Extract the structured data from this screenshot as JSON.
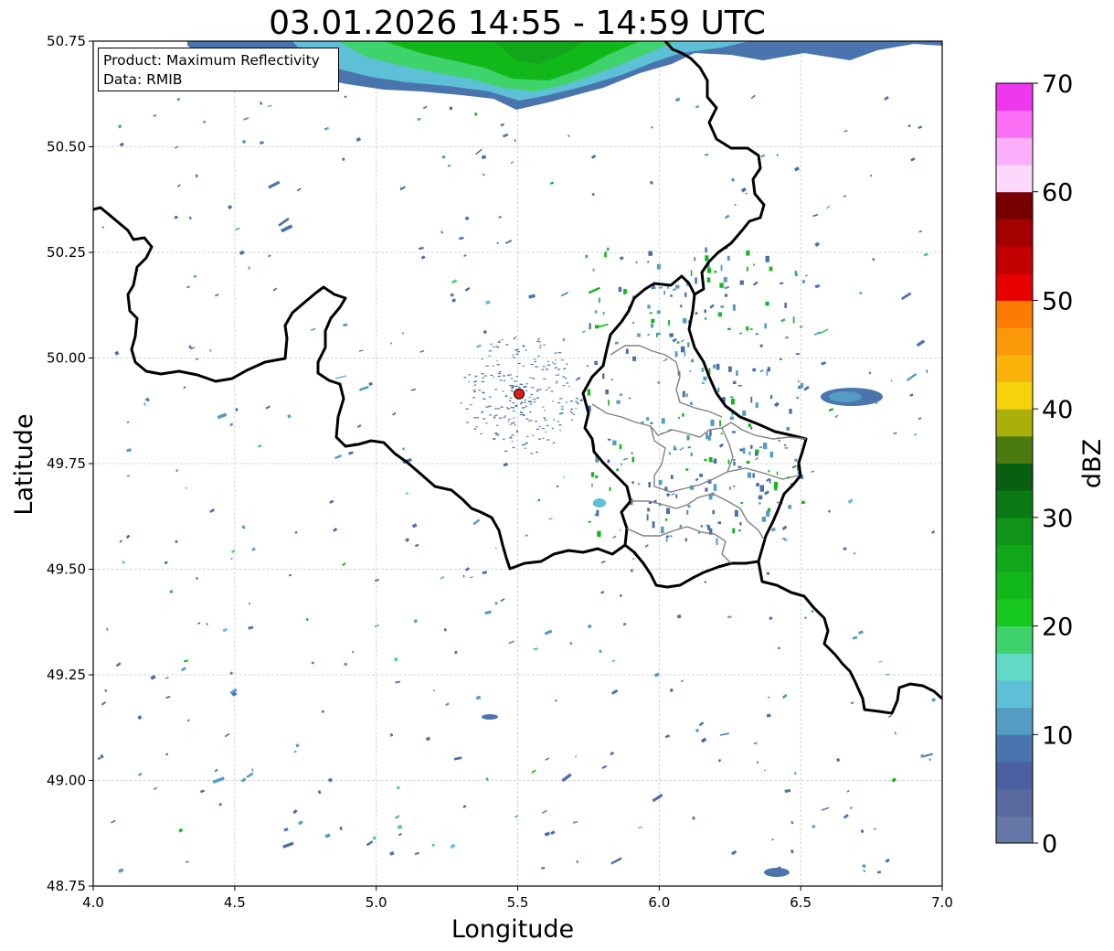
{
  "title": "03.01.2026 14:55 - 14:59 UTC",
  "info": {
    "line1": "Product: Maximum Reflectivity",
    "line2": "Data: RMIB"
  },
  "xaxis": {
    "label": "Longitude",
    "min": 4.0,
    "max": 7.0,
    "ticks": [
      4.0,
      4.5,
      5.0,
      5.5,
      6.0,
      6.5,
      7.0
    ],
    "tick_labels": [
      "4.0",
      "4.5",
      "5.0",
      "5.5",
      "6.0",
      "6.5",
      "7.0"
    ]
  },
  "yaxis": {
    "label": "Latitude",
    "min": 48.75,
    "max": 50.75,
    "ticks": [
      48.75,
      49.0,
      49.25,
      49.5,
      49.75,
      50.0,
      50.25,
      50.5,
      50.75
    ],
    "tick_labels": [
      "48.75",
      "49.00",
      "49.25",
      "49.50",
      "49.75",
      "50.00",
      "50.25",
      "50.50",
      "50.75"
    ]
  },
  "grid": true,
  "colorbar": {
    "label": "dBZ",
    "min": 0,
    "max": 70,
    "ticks": [
      0,
      10,
      20,
      30,
      40,
      50,
      60,
      70
    ],
    "tick_labels": [
      "0",
      "10",
      "20",
      "30",
      "40",
      "50",
      "60",
      "70"
    ],
    "colors": [
      "#6477a6",
      "#59689e",
      "#4c5fa0",
      "#4a74ad",
      "#539cc2",
      "#5ec0d6",
      "#62d9c4",
      "#3ed36b",
      "#16c81c",
      "#12b71a",
      "#10a71a",
      "#0f9417",
      "#0c7a14",
      "#085f10",
      "#4a7a10",
      "#a9b00a",
      "#f6d20a",
      "#f9b30a",
      "#fb980a",
      "#fb7b05",
      "#e60000",
      "#c20000",
      "#a30000",
      "#780000",
      "#fcd8fd",
      "#fcb0fc",
      "#fc70f6",
      "#ee37ee"
    ]
  },
  "radar_site": {
    "lon": 5.505,
    "lat": 49.915,
    "color": "#e31a1c"
  },
  "map": {
    "border_color": "#000000",
    "subdivision_color": "#808080",
    "echo_color": "#4a6ea8"
  }
}
